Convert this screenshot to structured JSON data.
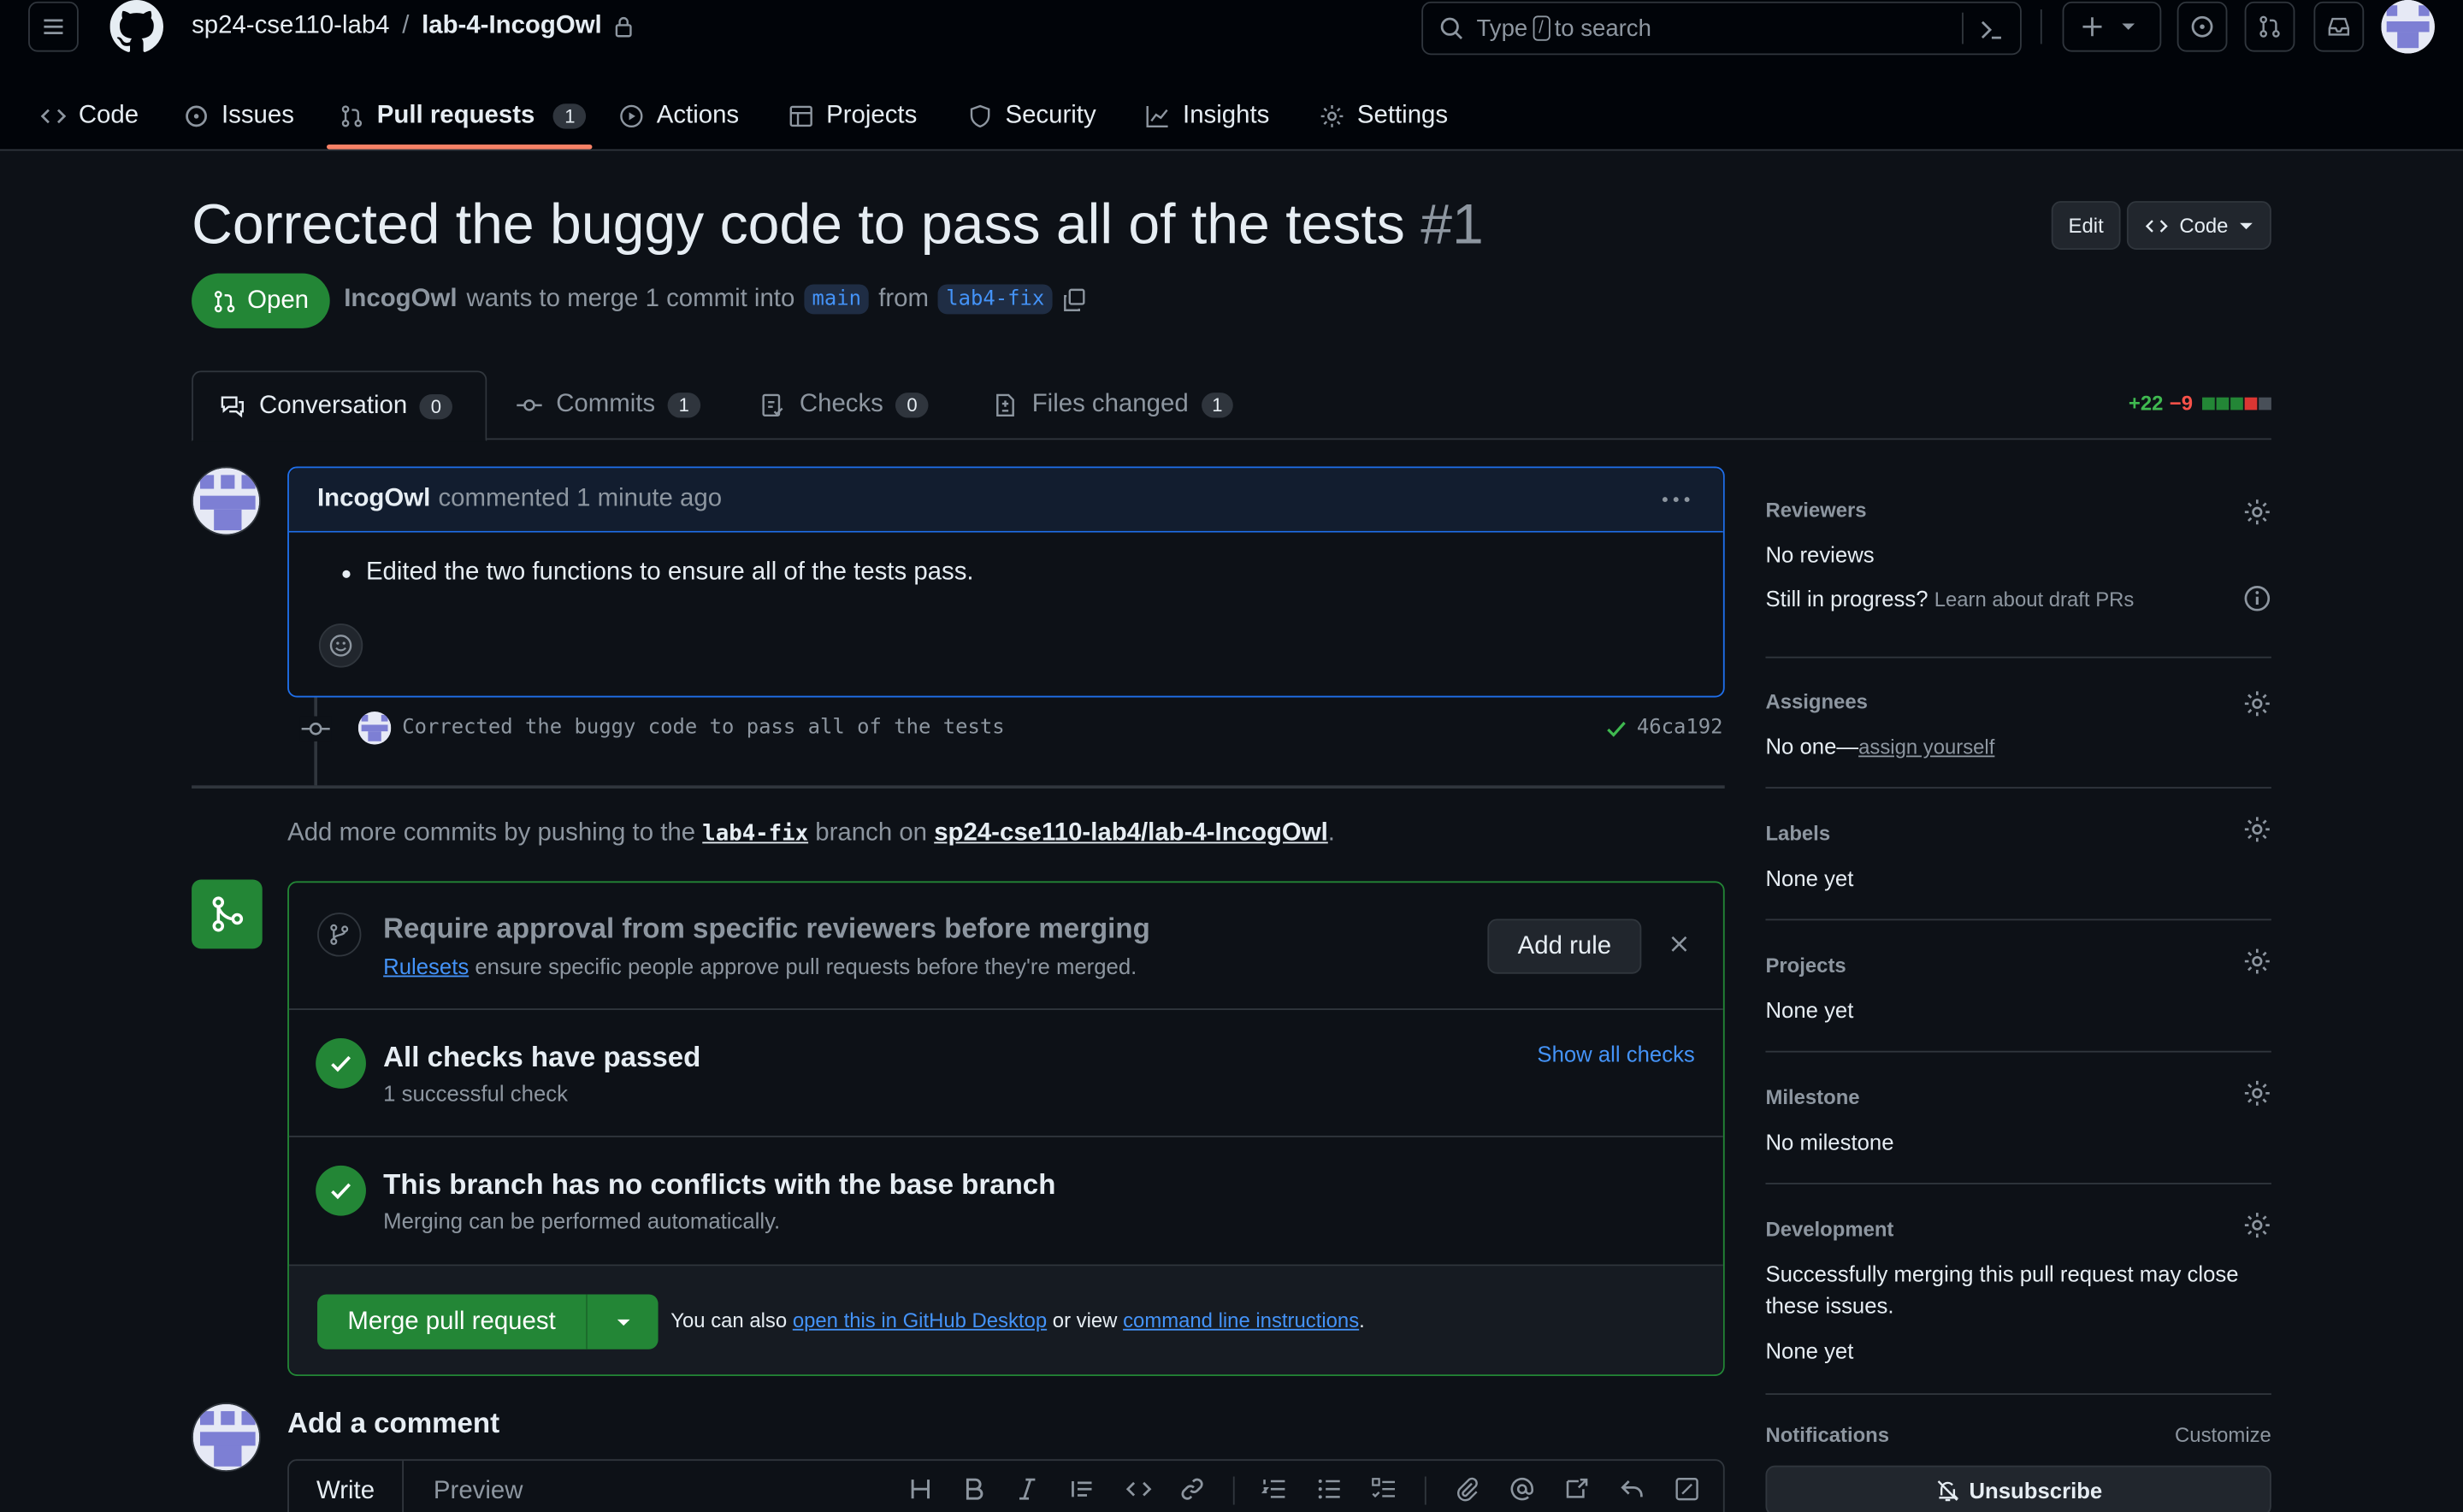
{
  "header": {
    "owner": "sp24-cse110-lab4",
    "separator": "/",
    "repo": "lab-4-IncogOwl",
    "search_prefix": "Type",
    "search_key": "/",
    "search_suffix": "to search"
  },
  "nav": {
    "code": "Code",
    "issues": "Issues",
    "pull_requests": "Pull requests",
    "pull_requests_count": "1",
    "actions": "Actions",
    "projects": "Projects",
    "security": "Security",
    "insights": "Insights",
    "settings": "Settings"
  },
  "pr": {
    "title": "Corrected the buggy code to pass all of the tests",
    "number": "#1",
    "edit_label": "Edit",
    "code_label": "Code",
    "state": "Open",
    "author": "IncogOwl",
    "merge_text": "wants to merge 1 commit into",
    "base": "main",
    "from_text": "from",
    "head": "lab4-fix"
  },
  "tabs": {
    "conversation": "Conversation",
    "conversation_count": "0",
    "commits": "Commits",
    "commits_count": "1",
    "checks": "Checks",
    "checks_count": "0",
    "files": "Files changed",
    "files_count": "1",
    "additions": "+22",
    "deletions": "−9"
  },
  "comment": {
    "author": "IncogOwl",
    "meta": "commented 1 minute ago",
    "body": "Edited the two functions to ensure all of the tests pass."
  },
  "commit": {
    "message": "Corrected the buggy code to pass all of the tests",
    "sha": "46ca192"
  },
  "push_hint": {
    "prefix": "Add more commits by pushing to the",
    "branch": "lab4-fix",
    "middle": "branch on",
    "repo": "sp24-cse110-lab4/lab-4-IncogOwl",
    "suffix": "."
  },
  "mergebox": {
    "rule_title": "Require approval from specific reviewers before merging",
    "rule_link": "Rulesets",
    "rule_desc": "ensure specific people approve pull requests before they're merged.",
    "add_rule": "Add rule",
    "checks_title": "All checks have passed",
    "checks_sub": "1 successful check",
    "show_checks": "Show all checks",
    "conflicts_title": "This branch has no conflicts with the base branch",
    "conflicts_sub": "Merging can be performed automatically.",
    "merge_label": "Merge pull request",
    "also_prefix": "You can also",
    "desktop_link": "open this in GitHub Desktop",
    "or_view": "or view",
    "cli_link": "command line instructions",
    "period": "."
  },
  "composer": {
    "heading": "Add a comment",
    "write_tab": "Write",
    "preview_tab": "Preview"
  },
  "sidebar": {
    "reviewers_h": "Reviewers",
    "reviewers_v": "No reviews",
    "draft_q": "Still in progress?",
    "draft_link": "Learn about draft PRs",
    "assignees_h": "Assignees",
    "assignees_v": "No one—",
    "assign_link": "assign yourself",
    "labels_h": "Labels",
    "labels_v": "None yet",
    "projects_h": "Projects",
    "projects_v": "None yet",
    "milestone_h": "Milestone",
    "milestone_v": "No milestone",
    "dev_h": "Development",
    "dev_desc": "Successfully merging this pull request may close these issues.",
    "dev_v": "None yet",
    "notif_h": "Notifications",
    "customize": "Customize",
    "unsubscribe": "Unsubscribe"
  }
}
